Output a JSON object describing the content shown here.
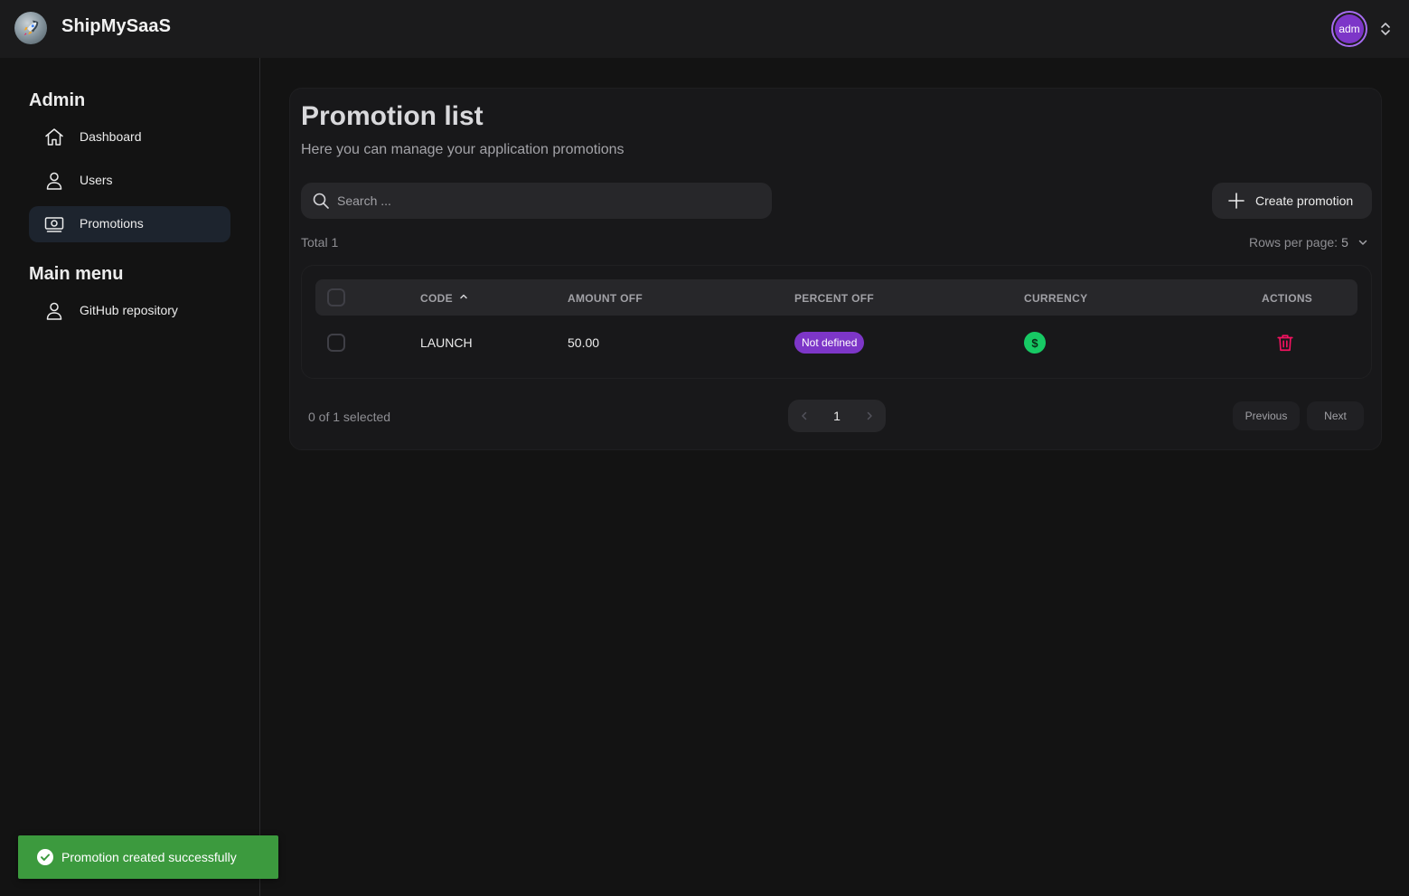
{
  "app": {
    "brand": "ShipMySaaS",
    "avatar_initials": "adm"
  },
  "sidebar": {
    "sections": [
      {
        "title": "Admin",
        "items": [
          {
            "label": "Dashboard",
            "icon": "home-icon",
            "active": false
          },
          {
            "label": "Users",
            "icon": "user-icon",
            "active": false
          },
          {
            "label": "Promotions",
            "icon": "money-icon",
            "active": true
          }
        ]
      },
      {
        "title": "Main menu",
        "items": [
          {
            "label": "GitHub repository",
            "icon": "user-icon",
            "active": false
          }
        ]
      }
    ]
  },
  "main": {
    "title": "Promotion list",
    "subtitle": "Here you can manage your application promotions",
    "search": {
      "placeholder": "Search ...",
      "value": ""
    },
    "create_button": "Create promotion",
    "total": "Total 1",
    "rows_per_page_label": "Rows per page:",
    "rows_per_page_value": "5",
    "table": {
      "columns": [
        "CODE",
        "AMOUNT OFF",
        "PERCENT OFF",
        "CURRENCY",
        "ACTIONS"
      ],
      "sort_column": "CODE",
      "sort_direction": "asc",
      "rows": [
        {
          "code": "LAUNCH",
          "amount_off": "50.00",
          "percent_off": "Not defined",
          "currency_symbol": "$"
        }
      ]
    },
    "selected_text": "0 of 1 selected",
    "pagination": {
      "current_page": "1",
      "previous": "Previous",
      "next": "Next"
    }
  },
  "toast": {
    "message": "Promotion created successfully"
  },
  "colors": {
    "accent_purple": "#7d36c8",
    "active_nav": "#1d242e",
    "success_green": "#17c964",
    "danger_red": "#f31260",
    "toast_green": "#3c9a3e"
  }
}
